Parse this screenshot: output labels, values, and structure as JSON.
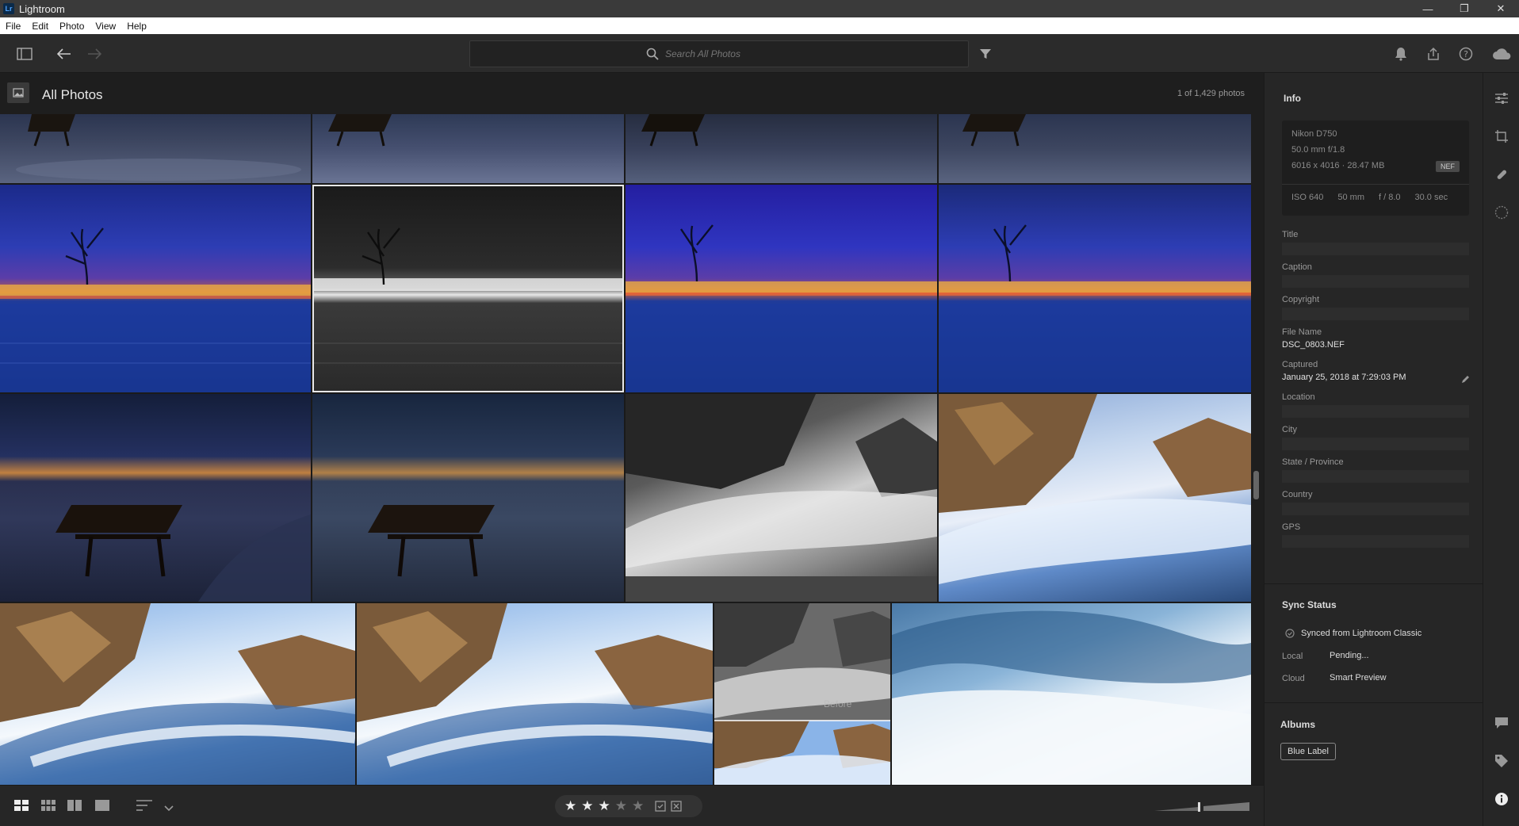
{
  "window": {
    "app_title": "Lightroom",
    "logo_text": "Lr",
    "minimize": "—",
    "restore": "❐",
    "close": "✕"
  },
  "menu": [
    "File",
    "Edit",
    "Photo",
    "View",
    "Help"
  ],
  "toolbar": {
    "search_placeholder": "Search All Photos"
  },
  "header": {
    "title": "All Photos",
    "count": "1 of 1,429 photos"
  },
  "rating": {
    "stars": 3,
    "max": 5
  },
  "info": {
    "title": "Info",
    "camera": "Nikon D750",
    "lens": "50.0 mm f/1.8",
    "dimensions": "6016 x 4016  ·  28.47 MB",
    "format": "NEF",
    "iso": "ISO 640",
    "focal": "50 mm",
    "aperture": "f / 8.0",
    "shutter": "30.0 sec",
    "fields": {
      "title_label": "Title",
      "caption_label": "Caption",
      "copyright_label": "Copyright",
      "filename_label": "File Name",
      "filename_value": "DSC_0803.NEF",
      "captured_label": "Captured",
      "captured_value": "January 25, 2018 at 7:29:03 PM",
      "location_label": "Location",
      "city_label": "City",
      "state_label": "State / Province",
      "country_label": "Country",
      "gps_label": "GPS"
    }
  },
  "sync": {
    "title": "Sync Status",
    "synced_from": "Synced from Lightroom Classic",
    "local_label": "Local",
    "local_value": "Pending...",
    "cloud_label": "Cloud",
    "cloud_value": "Smart Preview"
  },
  "albums": {
    "title": "Albums",
    "items": [
      "Blue Label"
    ]
  },
  "thumbnails": [
    {
      "name": "bench-snow-1"
    },
    {
      "name": "bench-snow-2"
    },
    {
      "name": "bench-snow-3"
    },
    {
      "name": "bench-snow-4"
    },
    {
      "name": "city-night-1"
    },
    {
      "name": "city-night-bw"
    },
    {
      "name": "city-night-2"
    },
    {
      "name": "city-night-3"
    },
    {
      "name": "bench-night-1"
    },
    {
      "name": "bench-night-2"
    },
    {
      "name": "rocks-waves-bw"
    },
    {
      "name": "rocks-waves-color-1"
    },
    {
      "name": "rocks-waves-color-2"
    },
    {
      "name": "rocks-waves-color-3"
    },
    {
      "name": "rocks-before-after"
    },
    {
      "name": "waves-closeup"
    }
  ],
  "overlay_text": {
    "before": "Before"
  }
}
